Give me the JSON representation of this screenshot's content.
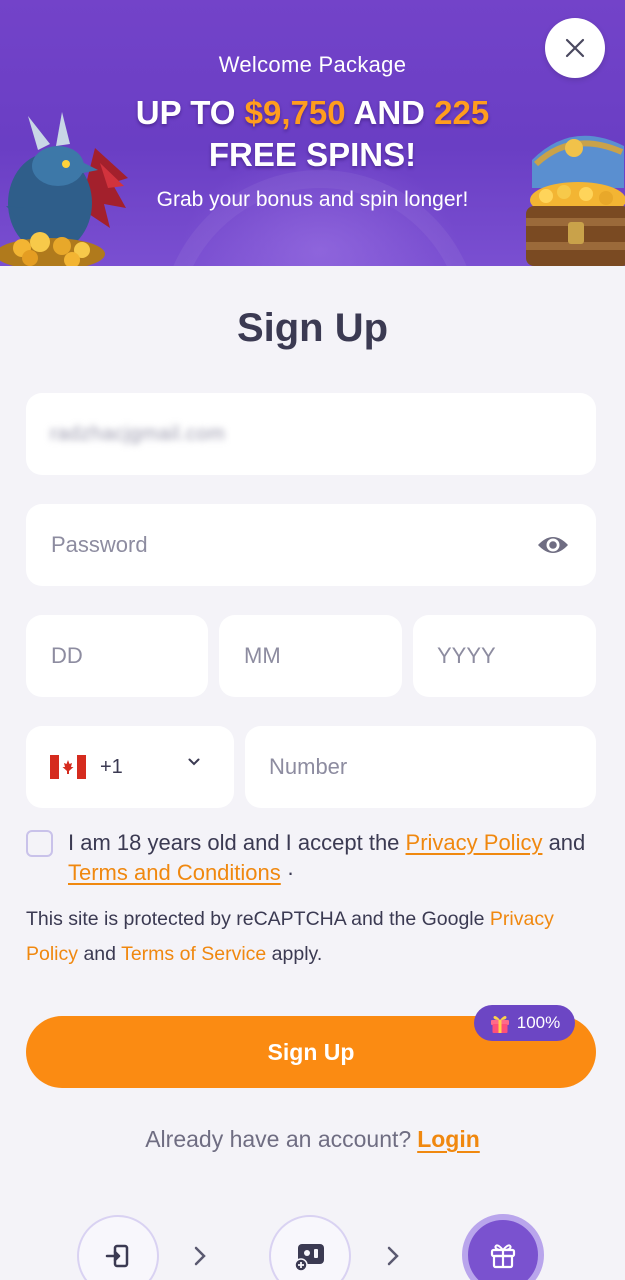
{
  "banner": {
    "welcome": "Welcome Package",
    "headline_prefix": "UP TO ",
    "headline_amount": "$9,750",
    "headline_mid": " AND ",
    "headline_spins": "225",
    "headline_line2": "FREE SPINS!",
    "subline": "Grab your bonus and spin longer!",
    "close_icon": "close-icon"
  },
  "form": {
    "title": "Sign Up",
    "email_value": "radzhacjgmail.com",
    "password_placeholder": "Password",
    "day_placeholder": "DD",
    "month_placeholder": "MM",
    "year_placeholder": "YYYY",
    "country_code": "+1",
    "country_flag": "canada-flag-icon",
    "phone_placeholder": "Number",
    "consent_before": "I am 18 years old and I accept the ",
    "privacy_link": "Privacy Policy",
    "consent_and": " and ",
    "terms_link": "Terms and Conditions",
    "consent_after": " ·",
    "recaptcha_before": "This site is protected by reCAPTCHA and the Google ",
    "recaptcha_privacy": "Privacy Policy",
    "recaptcha_and": " and ",
    "recaptcha_terms": "Terms of Service",
    "recaptcha_after": " apply.",
    "submit_label": "Sign Up",
    "bonus_badge": "100%",
    "already_text": "Already have an account?",
    "login_link": "Login"
  },
  "steps": [
    {
      "icon": "login-icon",
      "active": false
    },
    {
      "icon": "add-game-icon",
      "active": false
    },
    {
      "icon": "gift-icon",
      "active": true
    }
  ],
  "colors": {
    "banner": "#7343c9",
    "accent": "#fb8b12",
    "link": "#f0880f",
    "badge": "#6c46c4",
    "background": "#f4f3f8"
  }
}
